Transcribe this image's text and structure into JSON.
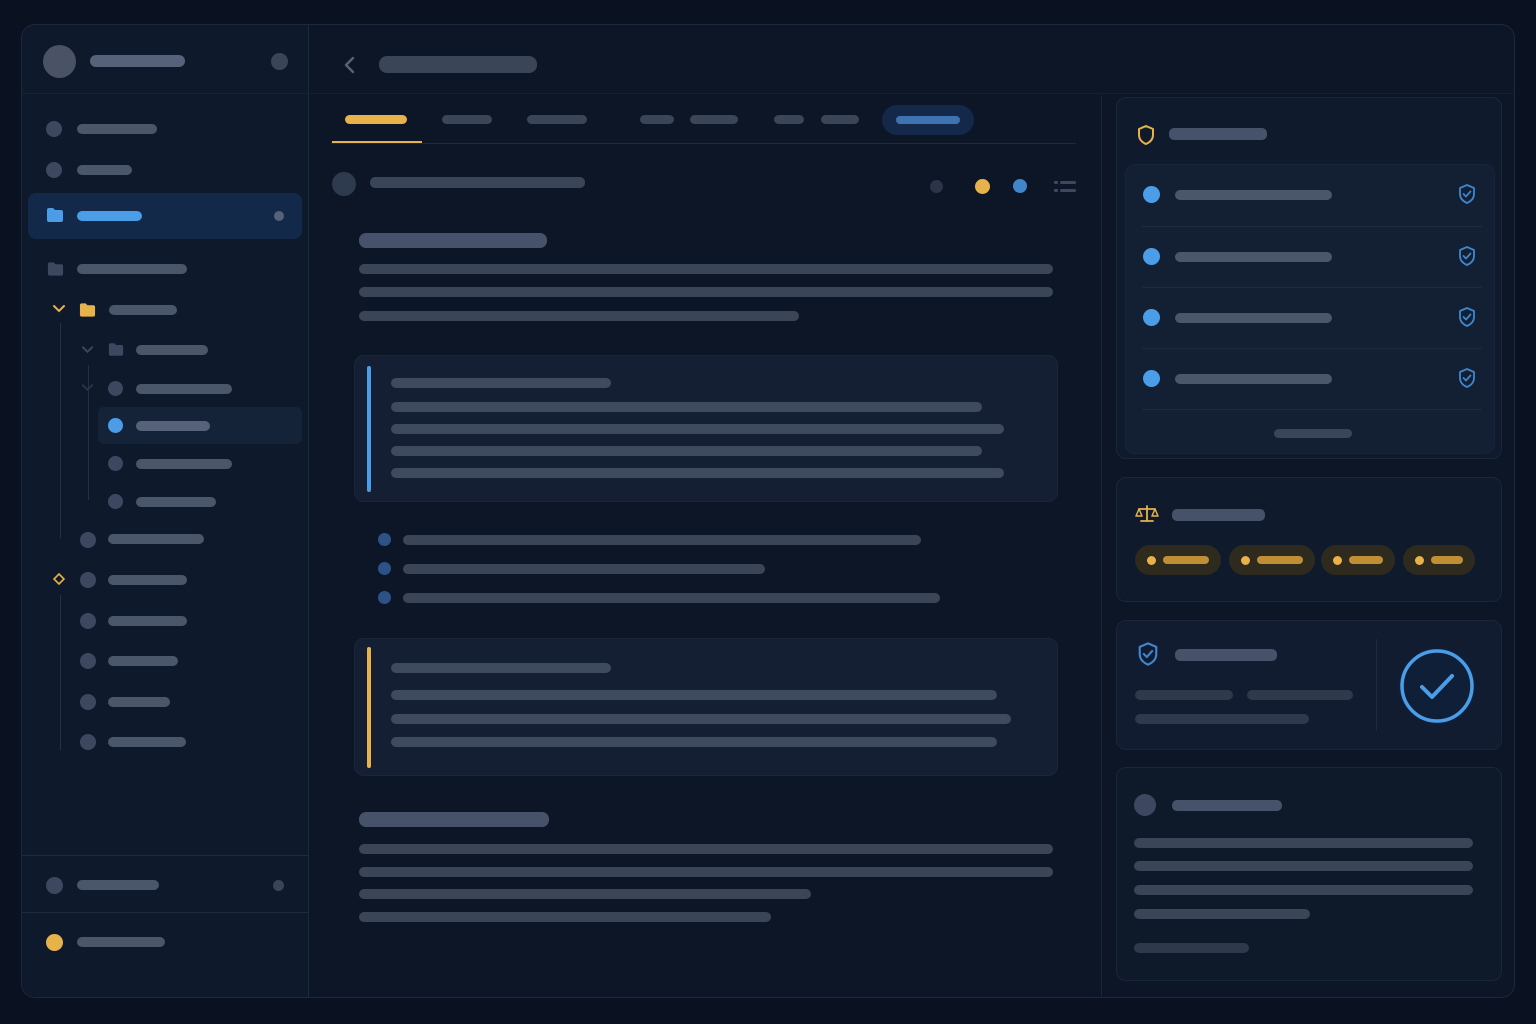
{
  "colors": {
    "background": "#0a1221",
    "panel": "#0c1627",
    "sidebar": "#0e1a2c",
    "accent_blue": "#4a9de6",
    "accent_gold": "#e8b24a",
    "text_placeholder": "#4a566a"
  },
  "icons": {
    "back": "chevron-left-icon",
    "folder": "folder-icon",
    "chevron": "chevron-down-icon",
    "shield": "shield-icon",
    "shield_check": "shield-check-icon",
    "scales": "scales-icon",
    "check": "check-circle-icon",
    "menu": "list-icon",
    "diamond": "diamond-icon"
  },
  "tabs": {
    "active_index": 0,
    "selected_pill_index": 7
  },
  "sidebar": {
    "selected_item": "folder-active",
    "tree_selected_item": "tree-leaf-2"
  },
  "panels": {
    "policy_list_count": 4,
    "tag_count": 4,
    "status_verified": true
  }
}
